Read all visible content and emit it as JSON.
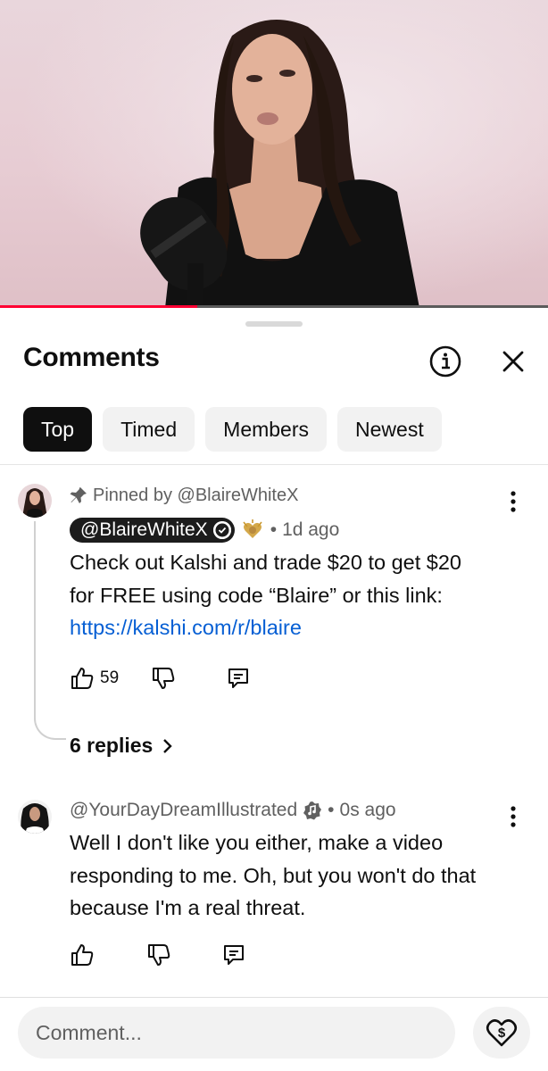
{
  "video": {
    "progress_fraction": 0.36
  },
  "comments_panel": {
    "title": "Comments",
    "info_icon": "info-icon",
    "close_icon": "close-icon",
    "tabs": [
      {
        "label": "Top",
        "active": true
      },
      {
        "label": "Timed",
        "active": false
      },
      {
        "label": "Members",
        "active": false
      },
      {
        "label": "Newest",
        "active": false
      }
    ]
  },
  "comments": [
    {
      "pinned_label": "Pinned by @BlaireWhiteX",
      "author": "@BlaireWhiteX",
      "verified": true,
      "time": "1d ago",
      "text_lines": [
        "Check out Kalshi and trade $20 to get $20",
        "for FREE using code “Blaire” or this link:"
      ],
      "link": "https://kalshi.com/r/blaire",
      "likes": "59",
      "replies_label": "6 replies"
    },
    {
      "author": "@YourDayDreamIllustrated",
      "time": "0s ago",
      "text_lines": [
        "Well I don't like you either, make a video",
        "responding to me. Oh, but you won't do that",
        "because I'm a real threat."
      ]
    }
  ],
  "composer": {
    "placeholder": "Comment...",
    "thanks_icon": "super-thanks-icon"
  },
  "colors": {
    "accent_red": "#ff0033",
    "link_blue": "#065fd4",
    "chip_bg": "#f2f2f2",
    "active_chip_bg": "#0f0f0f"
  }
}
